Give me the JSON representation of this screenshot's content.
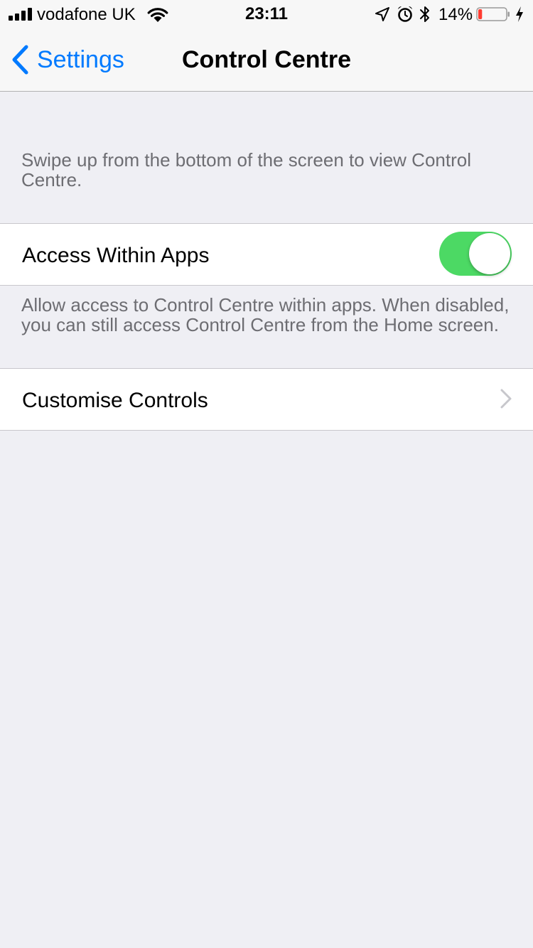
{
  "status_bar": {
    "carrier": "vodafone UK",
    "time": "23:11",
    "battery_percent": "14%",
    "battery_level": 0.14,
    "battery_color": "#ff3b30"
  },
  "nav": {
    "back_label": "Settings",
    "title": "Control Centre"
  },
  "content": {
    "intro": "Swipe up from the bottom of the screen to view Control Centre.",
    "access_within_apps": {
      "label": "Access Within Apps",
      "enabled": true
    },
    "access_footer": "Allow access to Control Centre within apps. When disabled, you can still access Control Centre from the Home screen.",
    "customise_controls": {
      "label": "Customise Controls"
    }
  },
  "colors": {
    "accent": "#007aff",
    "toggle_on": "#4cd964",
    "background": "#efeff4",
    "secondary_text": "#6d6d72"
  },
  "icons": {
    "status": [
      "signal-bars",
      "wifi-icon",
      "location-arrow-icon",
      "alarm-clock-icon",
      "bluetooth-icon",
      "battery-icon",
      "charging-bolt-icon"
    ],
    "nav_back": "chevron-left-icon",
    "row_disclosure": "chevron-right-icon"
  }
}
